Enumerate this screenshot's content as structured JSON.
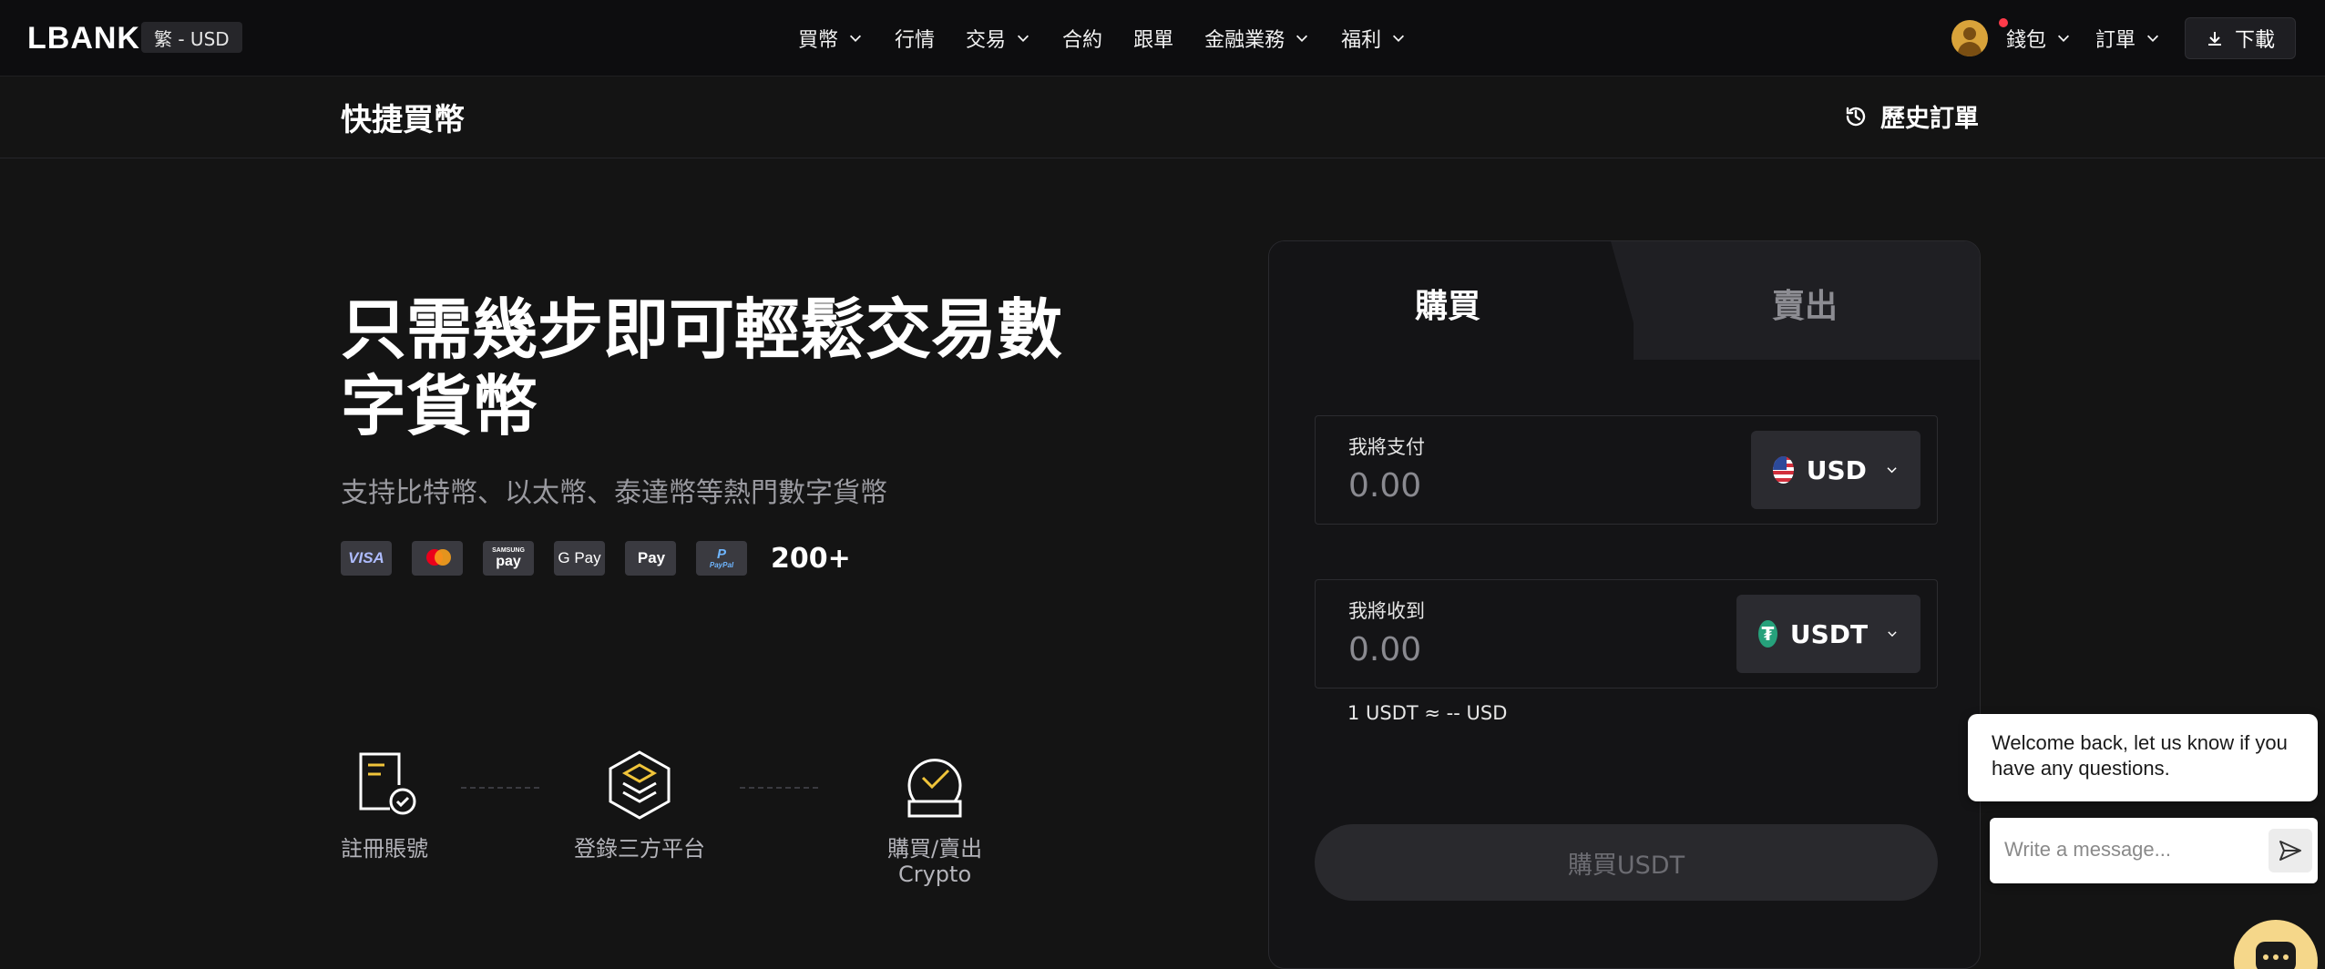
{
  "header": {
    "logo": "LBANK",
    "locale": "繁 - USD",
    "nav": [
      {
        "label": "買幣",
        "has_dropdown": true
      },
      {
        "label": "行情",
        "has_dropdown": false
      },
      {
        "label": "交易",
        "has_dropdown": true
      },
      {
        "label": "合約",
        "has_dropdown": false
      },
      {
        "label": "跟單",
        "has_dropdown": false
      },
      {
        "label": "金融業務",
        "has_dropdown": true
      },
      {
        "label": "福利",
        "has_dropdown": true
      }
    ],
    "wallet": "錢包",
    "orders": "訂單",
    "download": "下載"
  },
  "subheader": {
    "title": "快捷買幣",
    "history": "歷史訂單"
  },
  "hero": {
    "title_line1": "只需幾步即可輕鬆交易數",
    "title_line2": "字貨幣",
    "subtitle": "支持比特幣、以太幣、泰達幣等熱門數字貨幣",
    "payments": {
      "visa": "VISA",
      "samsung_top": "SAMSUNG",
      "samsung_bottom": "pay",
      "gpay": "G Pay",
      "applepay": "Pay",
      "paypal_top": "P",
      "paypal_bottom": "PayPal",
      "count": "200+"
    }
  },
  "steps": [
    {
      "label": "註冊賬號"
    },
    {
      "label": "登錄三方平台"
    },
    {
      "label_line1": "購買/賣出",
      "label_line2": "Crypto"
    }
  ],
  "trade": {
    "active_tab": "buy",
    "tab_buy": "購買",
    "tab_sell": "賣出",
    "pay": {
      "label": "我將支付",
      "value": "0.00",
      "currency": "USD"
    },
    "receive": {
      "label": "我將收到",
      "value": "0.00",
      "currency": "USDT"
    },
    "rate": "1 USDT ≈ -- USD",
    "submit": "購買USDT"
  },
  "chat": {
    "welcome": "Welcome back, let us know if you have any questions.",
    "placeholder": "Write a message..."
  },
  "colors": {
    "background": "#141414",
    "accent_yellow": "#f0c43a",
    "tether_green": "#26a17b",
    "notification_red": "#ff3b4a"
  }
}
